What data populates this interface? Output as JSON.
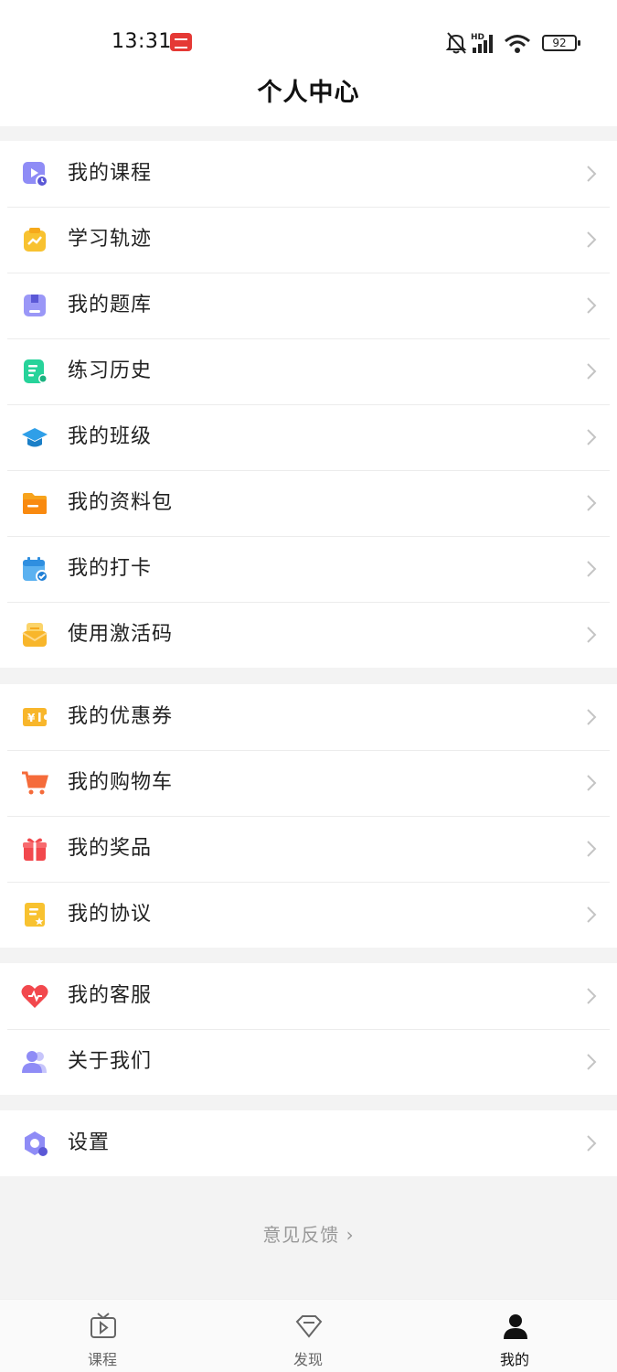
{
  "status_bar": {
    "time": "13:31",
    "battery": "92",
    "network": "HD"
  },
  "header": {
    "title": "个人中心"
  },
  "groups": [
    {
      "items": [
        {
          "label": "我的课程",
          "icon": "course-play-icon"
        },
        {
          "label": "学习轨迹",
          "icon": "learning-track-icon"
        },
        {
          "label": "我的题库",
          "icon": "question-bank-icon"
        },
        {
          "label": "练习历史",
          "icon": "practice-history-icon"
        },
        {
          "label": "我的班级",
          "icon": "class-graduation-cap-icon"
        },
        {
          "label": "我的资料包",
          "icon": "folder-icon"
        },
        {
          "label": "我的打卡",
          "icon": "calendar-check-icon"
        },
        {
          "label": "使用激活码",
          "icon": "activation-envelope-icon"
        }
      ]
    },
    {
      "items": [
        {
          "label": "我的优惠券",
          "icon": "coupon-icon"
        },
        {
          "label": "我的购物车",
          "icon": "shopping-cart-icon"
        },
        {
          "label": "我的奖品",
          "icon": "gift-icon"
        },
        {
          "label": "我的协议",
          "icon": "agreement-icon"
        }
      ]
    },
    {
      "items": [
        {
          "label": "我的客服",
          "icon": "heart-service-icon"
        },
        {
          "label": "关于我们",
          "icon": "about-users-icon"
        }
      ]
    },
    {
      "items": [
        {
          "label": "设置",
          "icon": "settings-icon"
        }
      ]
    }
  ],
  "feedback": {
    "label": "意见反馈 ›"
  },
  "tabbar": {
    "tabs": [
      {
        "label": "课程",
        "icon": "tv-play-icon",
        "active": false
      },
      {
        "label": "发现",
        "icon": "diamond-icon",
        "active": false
      },
      {
        "label": "我的",
        "icon": "user-icon",
        "active": true
      }
    ]
  },
  "colors": {
    "purple": "#8f8cf6",
    "yellow": "#f8c230",
    "green": "#27d39a",
    "blue": "#2f9fe8",
    "orange": "#f7a31c",
    "red": "#f2484d",
    "cart_orange": "#f56b3a"
  }
}
